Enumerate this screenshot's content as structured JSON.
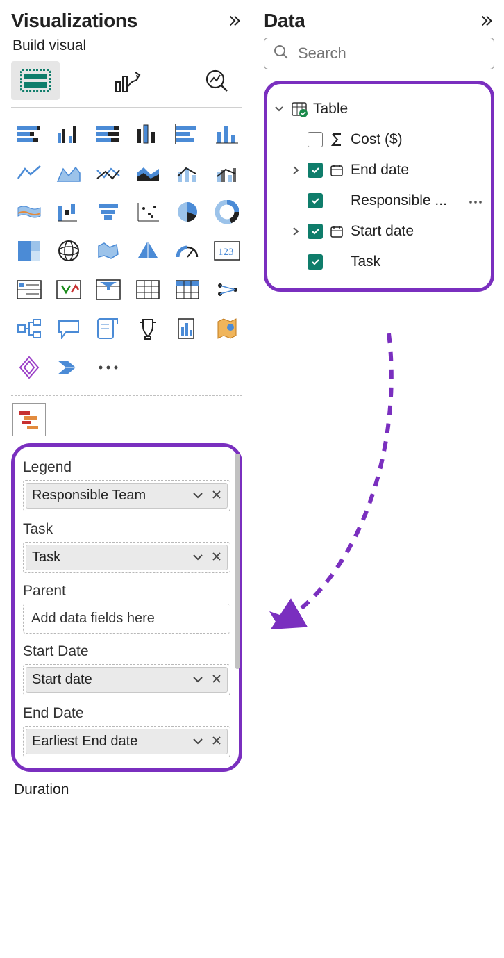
{
  "viz_panel": {
    "title": "Visualizations",
    "subtitle": "Build visual",
    "tabs": [
      "build",
      "format",
      "analytics"
    ],
    "gallery_icons": [
      "stacked-bar",
      "clustered-column",
      "stacked-bar-100",
      "clustered-bar",
      "stacked-column",
      "column-small",
      "line",
      "area",
      "line-multi",
      "area-stacked",
      "combo-line-col",
      "combo-line-col-2",
      "ribbon",
      "waterfall",
      "funnel",
      "scatter",
      "pie",
      "donut",
      "treemap",
      "globe",
      "filled-map",
      "shape-map",
      "gauge",
      "card",
      "multi-row-card",
      "kpi",
      "slicer",
      "table",
      "matrix",
      "r-visual",
      "decomposition",
      "qna",
      "key-influencer",
      "smart-narrative",
      "paginated",
      "arcgis",
      "powerapps",
      "powerautomate",
      "more"
    ],
    "selected_visual": "gantt",
    "wells": [
      {
        "label": "Legend",
        "value": "Responsible Team",
        "has_value": true
      },
      {
        "label": "Task",
        "value": "Task",
        "has_value": true
      },
      {
        "label": "Parent",
        "placeholder": "Add data fields here",
        "has_value": false
      },
      {
        "label": "Start Date",
        "value": "Start date",
        "has_value": true
      },
      {
        "label": "End Date",
        "value": "Earliest End date",
        "has_value": true
      }
    ],
    "extra_well_label": "Duration"
  },
  "data_panel": {
    "title": "Data",
    "search_placeholder": "Search",
    "table_name": "Table",
    "fields": [
      {
        "name": "Cost ($)",
        "checked": false,
        "type": "sum",
        "expandable": false
      },
      {
        "name": "End date",
        "checked": true,
        "type": "date",
        "expandable": true
      },
      {
        "name": "Responsible ...",
        "checked": true,
        "type": "text",
        "expandable": false,
        "has_more": true
      },
      {
        "name": "Start date",
        "checked": true,
        "type": "date",
        "expandable": true
      },
      {
        "name": "Task",
        "checked": true,
        "type": "text",
        "expandable": false
      }
    ]
  },
  "annotation": {
    "arrow_color": "#7a2fbf"
  }
}
